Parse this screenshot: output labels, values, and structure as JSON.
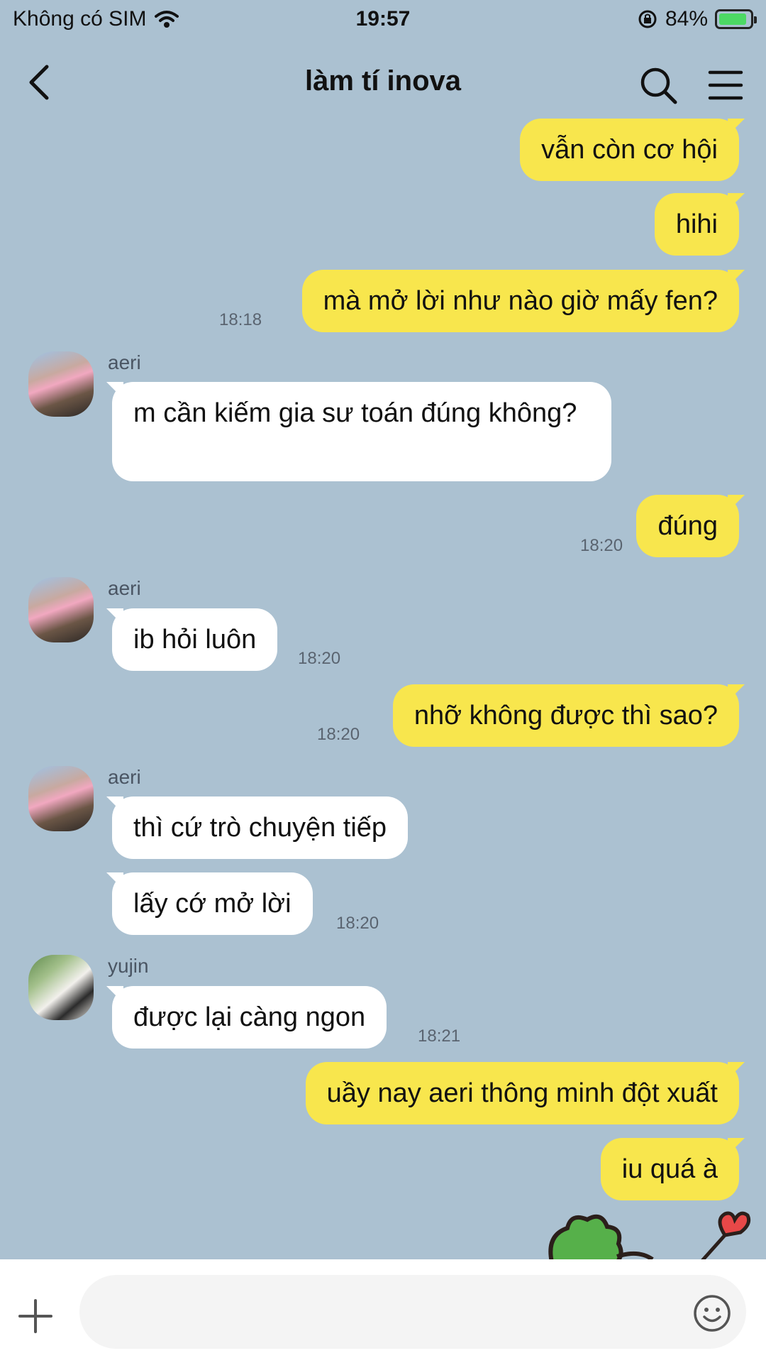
{
  "status_bar": {
    "carrier": "Không có SIM",
    "time": "19:57",
    "battery": "84%",
    "battery_level": 0.84
  },
  "header": {
    "title": "làm tí inova",
    "icons": [
      "back-icon",
      "search-icon",
      "menu-icon"
    ]
  },
  "messages": [
    {
      "from": "me",
      "text": "vẫn còn cơ hội"
    },
    {
      "from": "me",
      "text": "hihi"
    },
    {
      "from": "me",
      "text": "mà mở lời như nào giờ mấy fen?",
      "time": "18:18"
    },
    {
      "from": "aeri",
      "sender": "aeri",
      "text": "m cần kiếm gia sư toán đúng không?"
    },
    {
      "from": "me",
      "text": "đúng",
      "time": "18:20"
    },
    {
      "from": "aeri",
      "sender": "aeri",
      "text": "ib hỏi luôn",
      "time": "18:20"
    },
    {
      "from": "me",
      "text": "nhỡ không được thì sao?",
      "time": "18:20"
    },
    {
      "from": "aeri",
      "sender": "aeri",
      "text": "thì cứ trò chuyện tiếp"
    },
    {
      "from": "aeri",
      "text": "lấy cớ mở lời",
      "time": "18:20"
    },
    {
      "from": "yujin",
      "sender": "yujin",
      "text": "được lại càng ngon",
      "time": "18:21"
    },
    {
      "from": "me",
      "text": "uầy nay aeri thông minh đột xuất"
    },
    {
      "from": "me",
      "text": "iu quá à"
    }
  ],
  "input": {
    "placeholder": "",
    "icons": [
      "plus-icon",
      "emoji-icon"
    ]
  },
  "colors": {
    "background": "#abc1d1",
    "my_bubble": "#f8e64d",
    "their_bubble": "#ffffff"
  }
}
